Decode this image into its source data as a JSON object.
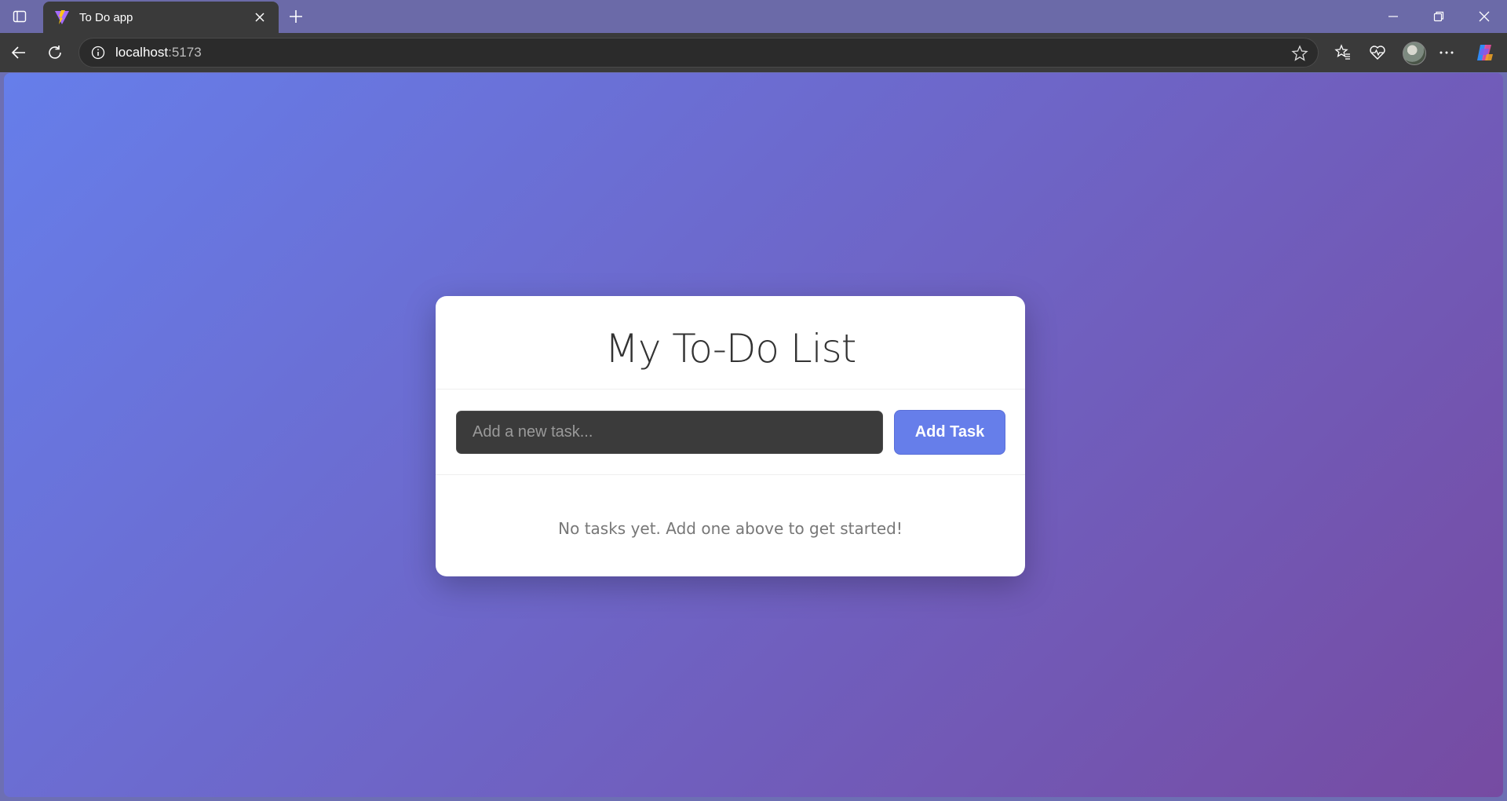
{
  "browser": {
    "tab_title": "To Do app",
    "url_host": "localhost",
    "url_port": ":5173"
  },
  "app": {
    "title": "My To-Do List",
    "input_placeholder": "Add a new task...",
    "add_button_label": "Add Task",
    "empty_message": "No tasks yet. Add one above to get started!"
  },
  "colors": {
    "gradient_start": "#667eea",
    "gradient_end": "#764ba2",
    "accent": "#667eea"
  }
}
